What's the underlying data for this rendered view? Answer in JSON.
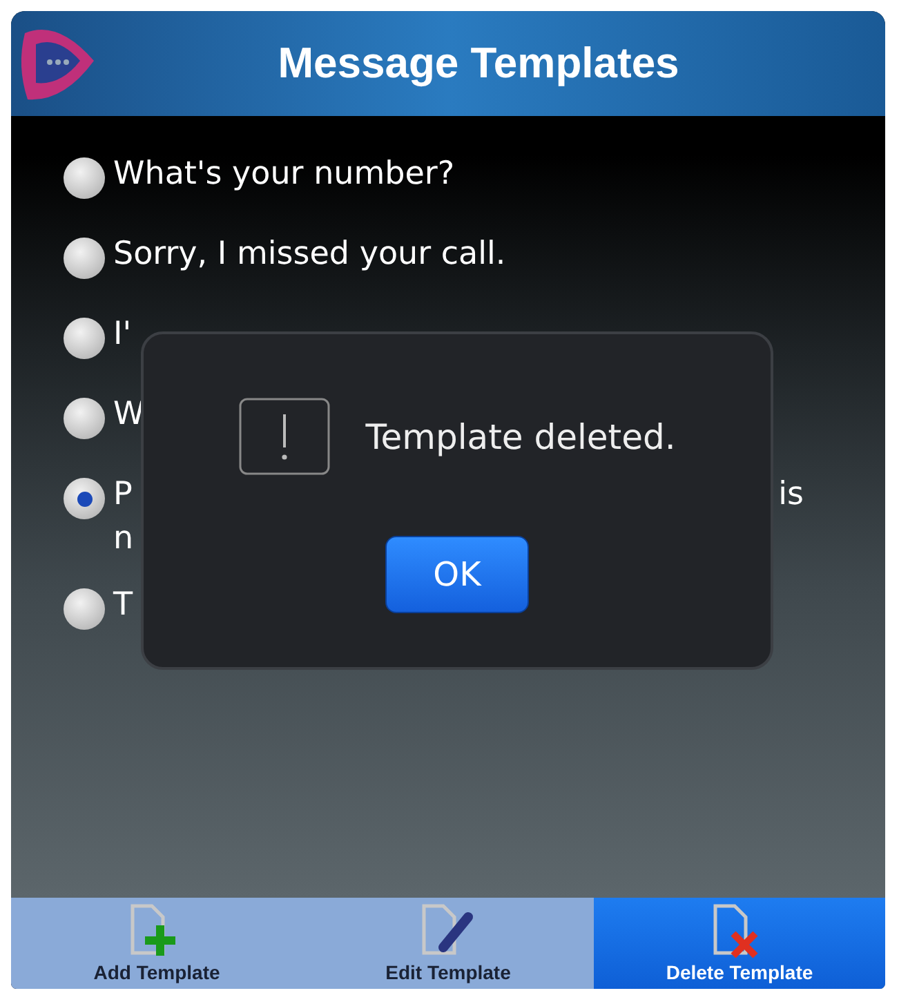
{
  "header": {
    "title": "Message Templates"
  },
  "templates": [
    {
      "selected": false,
      "lines": [
        {
          "left": "What's your number?"
        }
      ]
    },
    {
      "selected": false,
      "lines": [
        {
          "left": "Sorry, I missed your call."
        }
      ]
    },
    {
      "selected": false,
      "lines": [
        {
          "left": "I'"
        }
      ]
    },
    {
      "selected": false,
      "lines": [
        {
          "left": "W"
        }
      ]
    },
    {
      "selected": true,
      "lines": [
        {
          "left": "P",
          "right": "is"
        },
        {
          "left": "n"
        }
      ]
    },
    {
      "selected": false,
      "lines": [
        {
          "left": "T"
        }
      ]
    }
  ],
  "dialog": {
    "message": "Template deleted.",
    "button": "OK"
  },
  "toolbar": [
    {
      "kind": "add",
      "label": "Add Template",
      "selected": false
    },
    {
      "kind": "edit",
      "label": "Edit Template",
      "selected": false
    },
    {
      "kind": "delete",
      "label": "Delete Template",
      "selected": true
    }
  ]
}
